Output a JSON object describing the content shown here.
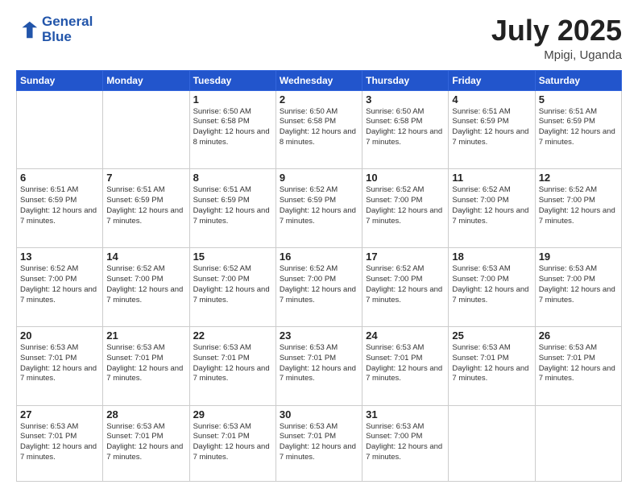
{
  "header": {
    "logo_line1": "General",
    "logo_line2": "Blue",
    "month_year": "July 2025",
    "location": "Mpigi, Uganda"
  },
  "weekdays": [
    "Sunday",
    "Monday",
    "Tuesday",
    "Wednesday",
    "Thursday",
    "Friday",
    "Saturday"
  ],
  "weeks": [
    [
      {
        "day": "",
        "empty": true
      },
      {
        "day": "",
        "empty": true
      },
      {
        "day": "1",
        "sunrise": "6:50 AM",
        "sunset": "6:58 PM",
        "daylight": "12 hours and 8 minutes."
      },
      {
        "day": "2",
        "sunrise": "6:50 AM",
        "sunset": "6:58 PM",
        "daylight": "12 hours and 8 minutes."
      },
      {
        "day": "3",
        "sunrise": "6:50 AM",
        "sunset": "6:58 PM",
        "daylight": "12 hours and 7 minutes."
      },
      {
        "day": "4",
        "sunrise": "6:51 AM",
        "sunset": "6:59 PM",
        "daylight": "12 hours and 7 minutes."
      },
      {
        "day": "5",
        "sunrise": "6:51 AM",
        "sunset": "6:59 PM",
        "daylight": "12 hours and 7 minutes."
      }
    ],
    [
      {
        "day": "6",
        "sunrise": "6:51 AM",
        "sunset": "6:59 PM",
        "daylight": "12 hours and 7 minutes."
      },
      {
        "day": "7",
        "sunrise": "6:51 AM",
        "sunset": "6:59 PM",
        "daylight": "12 hours and 7 minutes."
      },
      {
        "day": "8",
        "sunrise": "6:51 AM",
        "sunset": "6:59 PM",
        "daylight": "12 hours and 7 minutes."
      },
      {
        "day": "9",
        "sunrise": "6:52 AM",
        "sunset": "6:59 PM",
        "daylight": "12 hours and 7 minutes."
      },
      {
        "day": "10",
        "sunrise": "6:52 AM",
        "sunset": "7:00 PM",
        "daylight": "12 hours and 7 minutes."
      },
      {
        "day": "11",
        "sunrise": "6:52 AM",
        "sunset": "7:00 PM",
        "daylight": "12 hours and 7 minutes."
      },
      {
        "day": "12",
        "sunrise": "6:52 AM",
        "sunset": "7:00 PM",
        "daylight": "12 hours and 7 minutes."
      }
    ],
    [
      {
        "day": "13",
        "sunrise": "6:52 AM",
        "sunset": "7:00 PM",
        "daylight": "12 hours and 7 minutes."
      },
      {
        "day": "14",
        "sunrise": "6:52 AM",
        "sunset": "7:00 PM",
        "daylight": "12 hours and 7 minutes."
      },
      {
        "day": "15",
        "sunrise": "6:52 AM",
        "sunset": "7:00 PM",
        "daylight": "12 hours and 7 minutes."
      },
      {
        "day": "16",
        "sunrise": "6:52 AM",
        "sunset": "7:00 PM",
        "daylight": "12 hours and 7 minutes."
      },
      {
        "day": "17",
        "sunrise": "6:52 AM",
        "sunset": "7:00 PM",
        "daylight": "12 hours and 7 minutes."
      },
      {
        "day": "18",
        "sunrise": "6:53 AM",
        "sunset": "7:00 PM",
        "daylight": "12 hours and 7 minutes."
      },
      {
        "day": "19",
        "sunrise": "6:53 AM",
        "sunset": "7:00 PM",
        "daylight": "12 hours and 7 minutes."
      }
    ],
    [
      {
        "day": "20",
        "sunrise": "6:53 AM",
        "sunset": "7:01 PM",
        "daylight": "12 hours and 7 minutes."
      },
      {
        "day": "21",
        "sunrise": "6:53 AM",
        "sunset": "7:01 PM",
        "daylight": "12 hours and 7 minutes."
      },
      {
        "day": "22",
        "sunrise": "6:53 AM",
        "sunset": "7:01 PM",
        "daylight": "12 hours and 7 minutes."
      },
      {
        "day": "23",
        "sunrise": "6:53 AM",
        "sunset": "7:01 PM",
        "daylight": "12 hours and 7 minutes."
      },
      {
        "day": "24",
        "sunrise": "6:53 AM",
        "sunset": "7:01 PM",
        "daylight": "12 hours and 7 minutes."
      },
      {
        "day": "25",
        "sunrise": "6:53 AM",
        "sunset": "7:01 PM",
        "daylight": "12 hours and 7 minutes."
      },
      {
        "day": "26",
        "sunrise": "6:53 AM",
        "sunset": "7:01 PM",
        "daylight": "12 hours and 7 minutes."
      }
    ],
    [
      {
        "day": "27",
        "sunrise": "6:53 AM",
        "sunset": "7:01 PM",
        "daylight": "12 hours and 7 minutes."
      },
      {
        "day": "28",
        "sunrise": "6:53 AM",
        "sunset": "7:01 PM",
        "daylight": "12 hours and 7 minutes."
      },
      {
        "day": "29",
        "sunrise": "6:53 AM",
        "sunset": "7:01 PM",
        "daylight": "12 hours and 7 minutes."
      },
      {
        "day": "30",
        "sunrise": "6:53 AM",
        "sunset": "7:01 PM",
        "daylight": "12 hours and 7 minutes."
      },
      {
        "day": "31",
        "sunrise": "6:53 AM",
        "sunset": "7:00 PM",
        "daylight": "12 hours and 7 minutes."
      },
      {
        "day": "",
        "empty": true
      },
      {
        "day": "",
        "empty": true
      }
    ]
  ]
}
